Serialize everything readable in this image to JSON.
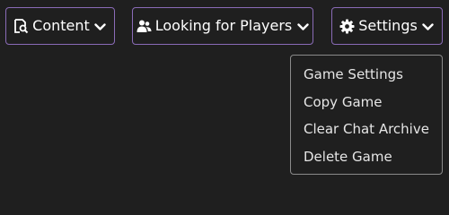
{
  "toolbar": {
    "content": {
      "label": "Content",
      "icon": "search-document-icon"
    },
    "lfp": {
      "label": "Looking for Players",
      "icon": "users-icon"
    },
    "settings": {
      "label": "Settings",
      "icon": "gear-icon"
    },
    "chevron_icon": "chevron-down-icon"
  },
  "settings_menu": {
    "items": [
      {
        "label": "Game Settings"
      },
      {
        "label": "Copy Game"
      },
      {
        "label": "Clear Chat Archive"
      },
      {
        "label": "Delete Game"
      }
    ]
  },
  "colors": {
    "background": "#1f1f1f",
    "button_border": "#8a6bb7",
    "menu_border": "#8a8a8a",
    "text": "#ffffff"
  }
}
